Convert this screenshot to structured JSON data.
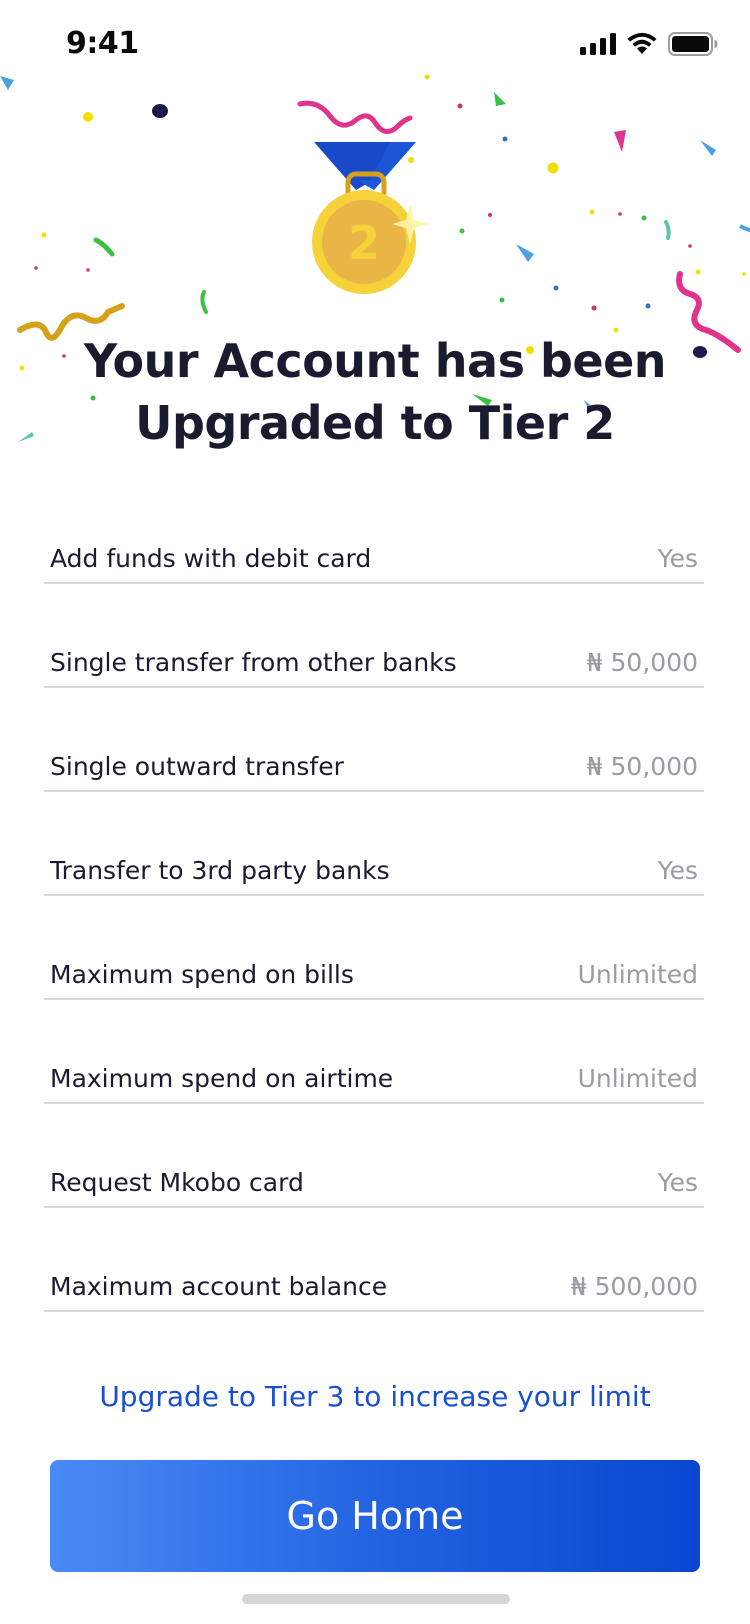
{
  "status_bar": {
    "time": "9:41",
    "icons": [
      "cellular-signal-icon",
      "wifi-icon",
      "battery-icon"
    ]
  },
  "hero": {
    "icon": "medal-icon",
    "medal_number": "2",
    "title_line1": "Your Account has been",
    "title_line2": "Upgraded to Tier 2"
  },
  "limits": [
    {
      "label": "Add funds with debit card",
      "value": "Yes"
    },
    {
      "label": "Single transfer from other banks",
      "value": "₦ 50,000"
    },
    {
      "label": "Single outward transfer",
      "value": "₦ 50,000"
    },
    {
      "label": "Transfer to 3rd party banks",
      "value": "Yes"
    },
    {
      "label": "Maximum spend on bills",
      "value": "Unlimited"
    },
    {
      "label": "Maximum spend on airtime",
      "value": "Unlimited"
    },
    {
      "label": "Request Mkobo card",
      "value": "Yes"
    },
    {
      "label": "Maximum account balance",
      "value": "₦ 500,000"
    }
  ],
  "upgrade_link": "Upgrade to Tier 3 to increase your limit",
  "go_home_button": "Go Home",
  "colors": {
    "primary": "#1a4fd0",
    "button_gradient_start": "#4a8af5",
    "button_gradient_end": "#0a46cf",
    "medal_gold": "#f3c623",
    "ribbon_blue": "#1849c9"
  }
}
